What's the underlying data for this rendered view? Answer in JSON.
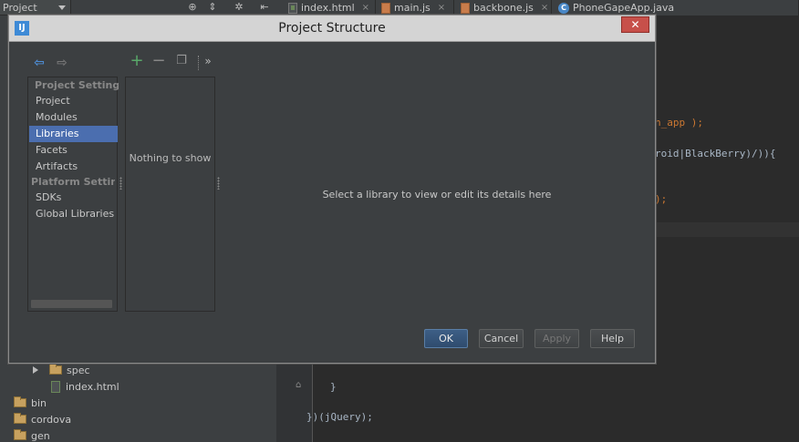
{
  "ide": {
    "project_dropdown": "Project",
    "tabs": [
      {
        "label": "index.html",
        "type": "html"
      },
      {
        "label": "main.js",
        "type": "js"
      },
      {
        "label": "backbone.js",
        "type": "js"
      },
      {
        "label": "PhoneGapeApp.java",
        "type": "java"
      }
    ],
    "tab_close_glyph": "×"
  },
  "tree": {
    "items": [
      {
        "label": "spec",
        "kind": "folder",
        "expandable": true
      },
      {
        "label": "index.html",
        "kind": "html-file"
      },
      {
        "label": "bin",
        "kind": "folder"
      },
      {
        "label": "cordova",
        "kind": "folder"
      },
      {
        "label": "gen",
        "kind": "folder"
      }
    ]
  },
  "editor": {
    "lines": [
      {
        "text": "h_app );",
        "color": "#cc7832"
      },
      {
        "text": "roid|BlackBerry)/)){",
        "color": "#a9b7c6"
      },
      {
        "text": ");",
        "color": "#cc7832"
      },
      {
        "text": "}",
        "color": "#a9b7c6"
      },
      {
        "text": "})(jQuery);",
        "color": "#a9b7c6"
      }
    ]
  },
  "dialog": {
    "title": "Project Structure",
    "close_glyph": "✕",
    "nav": {
      "back_icon": "back-arrow-icon",
      "forward_icon": "forward-arrow-icon",
      "sections": [
        {
          "header": "Project Settings",
          "items": [
            "Project",
            "Modules",
            "Libraries",
            "Facets",
            "Artifacts"
          ]
        },
        {
          "header": "Platform Settings",
          "items": [
            "SDKs",
            "Global Libraries"
          ]
        }
      ],
      "selected": "Libraries"
    },
    "libraries": {
      "add_glyph": "+",
      "remove_glyph": "−",
      "more_glyph": "»",
      "empty_text": "Nothing to show"
    },
    "detail_message": "Select a library to view or edit its details here",
    "buttons": {
      "ok": "OK",
      "cancel": "Cancel",
      "apply": "Apply",
      "help": "Help"
    }
  },
  "colors": {
    "selection": "#4b6eaf",
    "add_green": "#59a869",
    "nav_arrow_blue": "#4e8ed6",
    "close_red": "#c7504a"
  }
}
